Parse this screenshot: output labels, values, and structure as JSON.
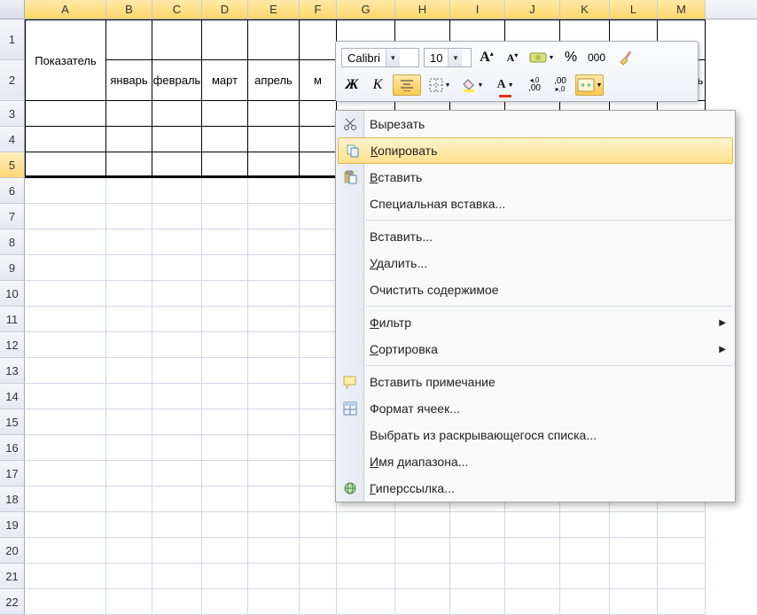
{
  "columns": [
    {
      "letter": "A",
      "width": 92,
      "sel": true
    },
    {
      "letter": "B",
      "width": 52,
      "sel": true
    },
    {
      "letter": "C",
      "width": 56,
      "sel": true
    },
    {
      "letter": "D",
      "width": 52,
      "sel": true
    },
    {
      "letter": "E",
      "width": 58,
      "sel": true
    },
    {
      "letter": "F",
      "width": 42,
      "sel": true
    },
    {
      "letter": "G",
      "width": 66,
      "sel": true
    },
    {
      "letter": "H",
      "width": 62,
      "sel": true
    },
    {
      "letter": "I",
      "width": 62,
      "sel": true
    },
    {
      "letter": "J",
      "width": 62,
      "sel": true
    },
    {
      "letter": "K",
      "width": 56,
      "sel": true
    },
    {
      "letter": "L",
      "width": 54,
      "sel": true
    },
    {
      "letter": "M",
      "width": 54,
      "sel": true
    }
  ],
  "row_numbers": [
    1,
    2,
    3,
    4,
    5,
    6,
    7,
    8,
    9,
    10,
    11,
    12,
    13,
    14,
    15,
    16,
    17,
    18,
    19,
    20,
    21,
    22
  ],
  "selected_row": 5,
  "merged_a": "Показатель",
  "months": [
    "январь",
    "февраль",
    "март",
    "апрель",
    "м",
    "",
    "",
    "",
    "",
    "",
    "",
    "декабрь"
  ],
  "mini": {
    "font_name": "Calibri",
    "font_size": "10",
    "grow": "A",
    "shrink": "A",
    "percent": "%",
    "thousands": "000",
    "bold": "Ж",
    "italic": "К",
    "inc_dec_a": ",00",
    "inc_dec_b": ",0"
  },
  "ctx": {
    "cut": "Вырезать",
    "copy": "Копировать",
    "paste": "Вставить",
    "paste_special": "Специальная вставка...",
    "insert": "Вставить...",
    "delete": "Удалить...",
    "clear": "Очистить содержимое",
    "filter": "Фильтр",
    "sort": "Сортировка",
    "comment": "Вставить примечание",
    "format": "Формат ячеек...",
    "dropdown": "Выбрать из раскрывающегося списка...",
    "range_name": "Имя диапазона...",
    "hyperlink": "Гиперссылка..."
  }
}
